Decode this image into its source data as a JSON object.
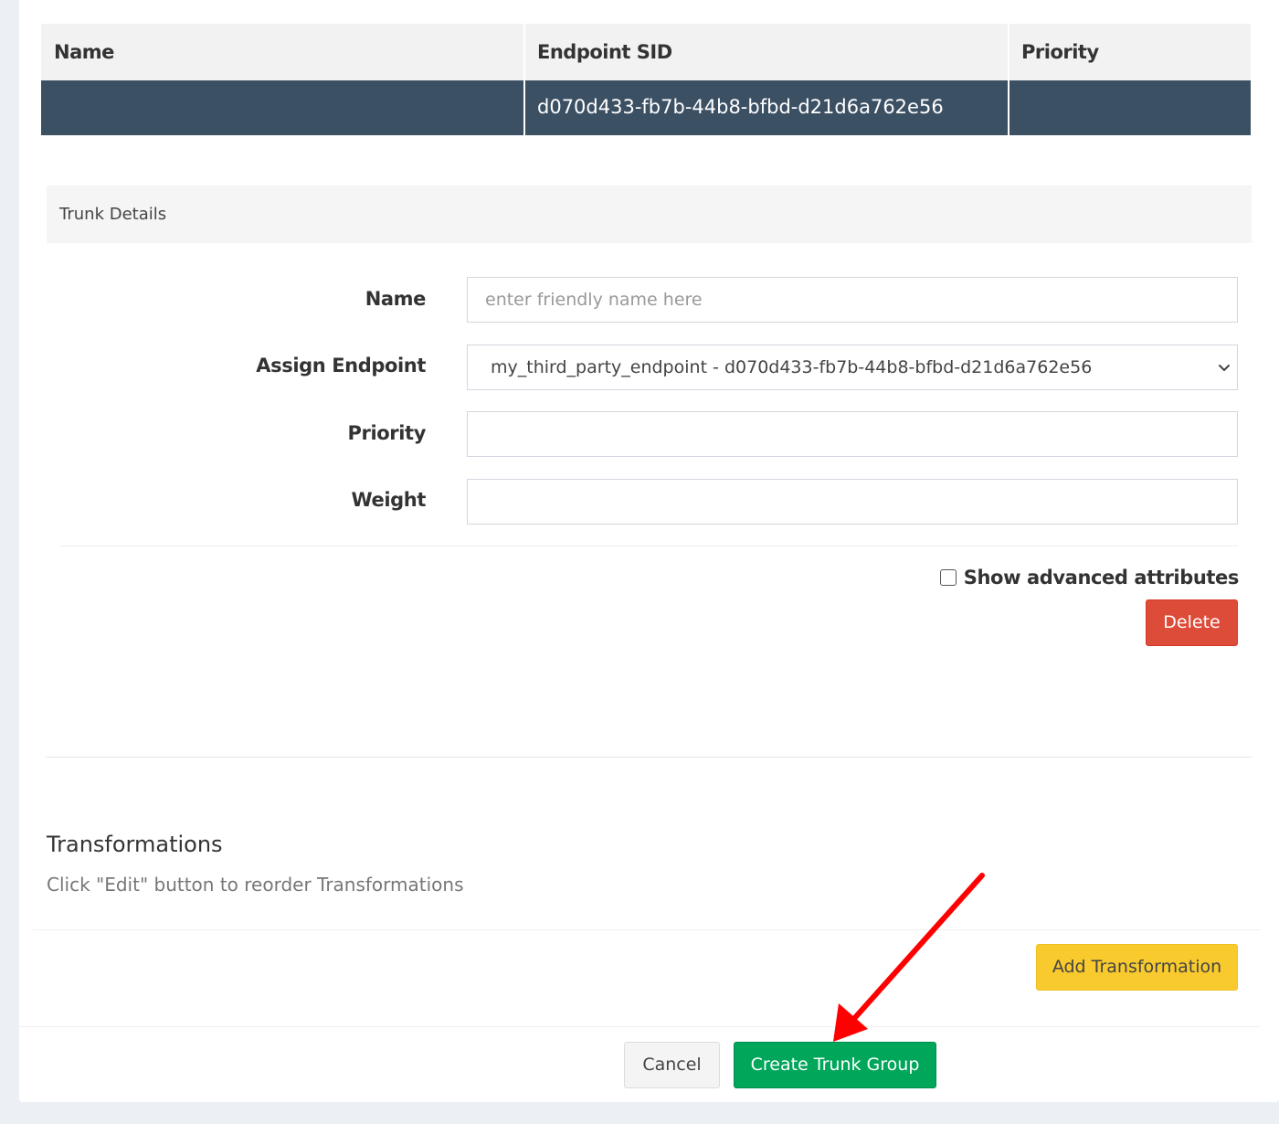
{
  "table": {
    "headers": {
      "name": "Name",
      "endpoint_sid": "Endpoint SID",
      "priority": "Priority"
    },
    "row": {
      "name": "",
      "endpoint_sid": "d070d433-fb7b-44b8-bfbd-d21d6a762e56",
      "priority": ""
    }
  },
  "trunk_details": {
    "title": "Trunk Details",
    "name_label": "Name",
    "name_value": "",
    "name_placeholder": "enter friendly name here",
    "endpoint_label": "Assign Endpoint",
    "endpoint_selected": "my_third_party_endpoint - d070d433-fb7b-44b8-bfbd-d21d6a762e56",
    "priority_label": "Priority",
    "priority_value": "",
    "weight_label": "Weight",
    "weight_value": "",
    "advanced_label": "Show advanced attributes",
    "advanced_checked": false,
    "delete_label": "Delete"
  },
  "transformations": {
    "title": "Transformations",
    "help": "Click \"Edit\" button to reorder Transformations",
    "add_label": "Add Transformation"
  },
  "footer": {
    "cancel_label": "Cancel",
    "create_label": "Create Trunk Group"
  },
  "colors": {
    "row_bg": "#3c5064",
    "danger": "#dd4b39",
    "warning": "#f8ca2d",
    "success": "#00a65a",
    "annotation_arrow": "#ff0000"
  },
  "icons": {
    "select_arrow": "chevron-down-icon",
    "annotation": "red-arrow-annotation"
  }
}
